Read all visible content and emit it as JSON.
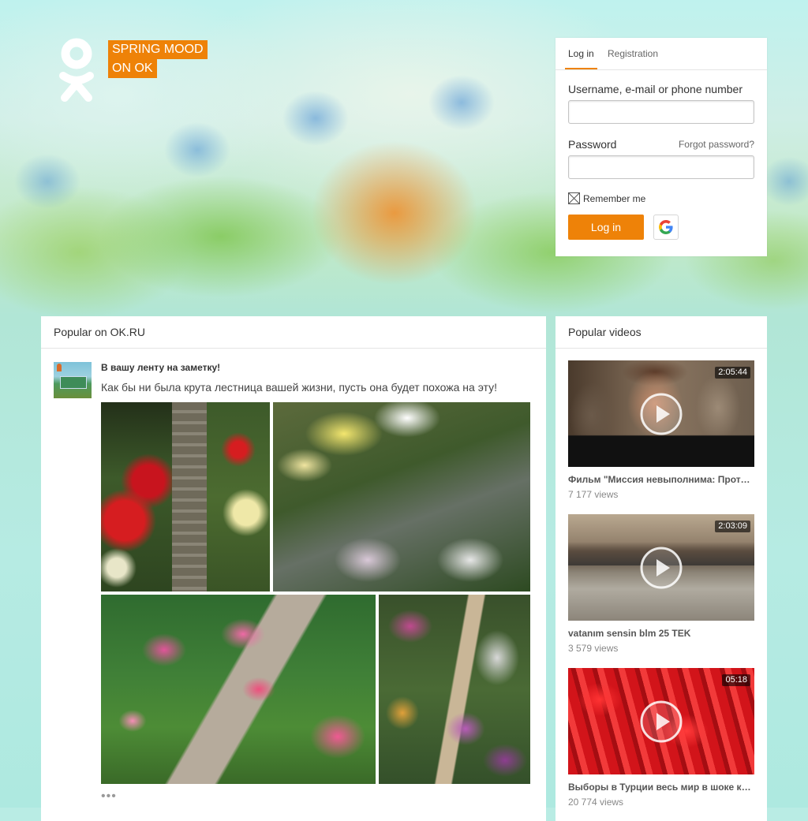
{
  "header": {
    "slogan_line1": "SPRING MOOD",
    "slogan_line2": "ON OK",
    "logo_icon": "ok-logo-icon",
    "brand_color": "#ee8208"
  },
  "login": {
    "tabs": [
      {
        "label": "Log in",
        "active": true
      },
      {
        "label": "Registration",
        "active": false
      }
    ],
    "username_label": "Username, e-mail or phone number",
    "username_value": "",
    "password_label": "Password",
    "password_value": "",
    "forgot_label": "Forgot password?",
    "remember_label": "Remember me",
    "login_button": "Log in",
    "google_icon": "google-icon"
  },
  "popular": {
    "title": "Popular on OK.RU",
    "post": {
      "author": "В вашу ленту на заметку!",
      "text": "Как бы ни была крута лестница вашей жизни, пусть она будет похожа на эту!",
      "more": "•••"
    }
  },
  "videos": {
    "title": "Popular videos",
    "items": [
      {
        "duration": "2:05:44",
        "title": "Фильм \"Миссия невыполнима: Протокол Фантом\"",
        "views": "7 177 views"
      },
      {
        "duration": "2:03:09",
        "title": "vatanım sensin blm 25 TEK",
        "views": "3 579 views"
      },
      {
        "duration": "05:18",
        "title": "Выборы в Турции весь мир в шоке как ...",
        "views": "20 774 views"
      }
    ]
  }
}
